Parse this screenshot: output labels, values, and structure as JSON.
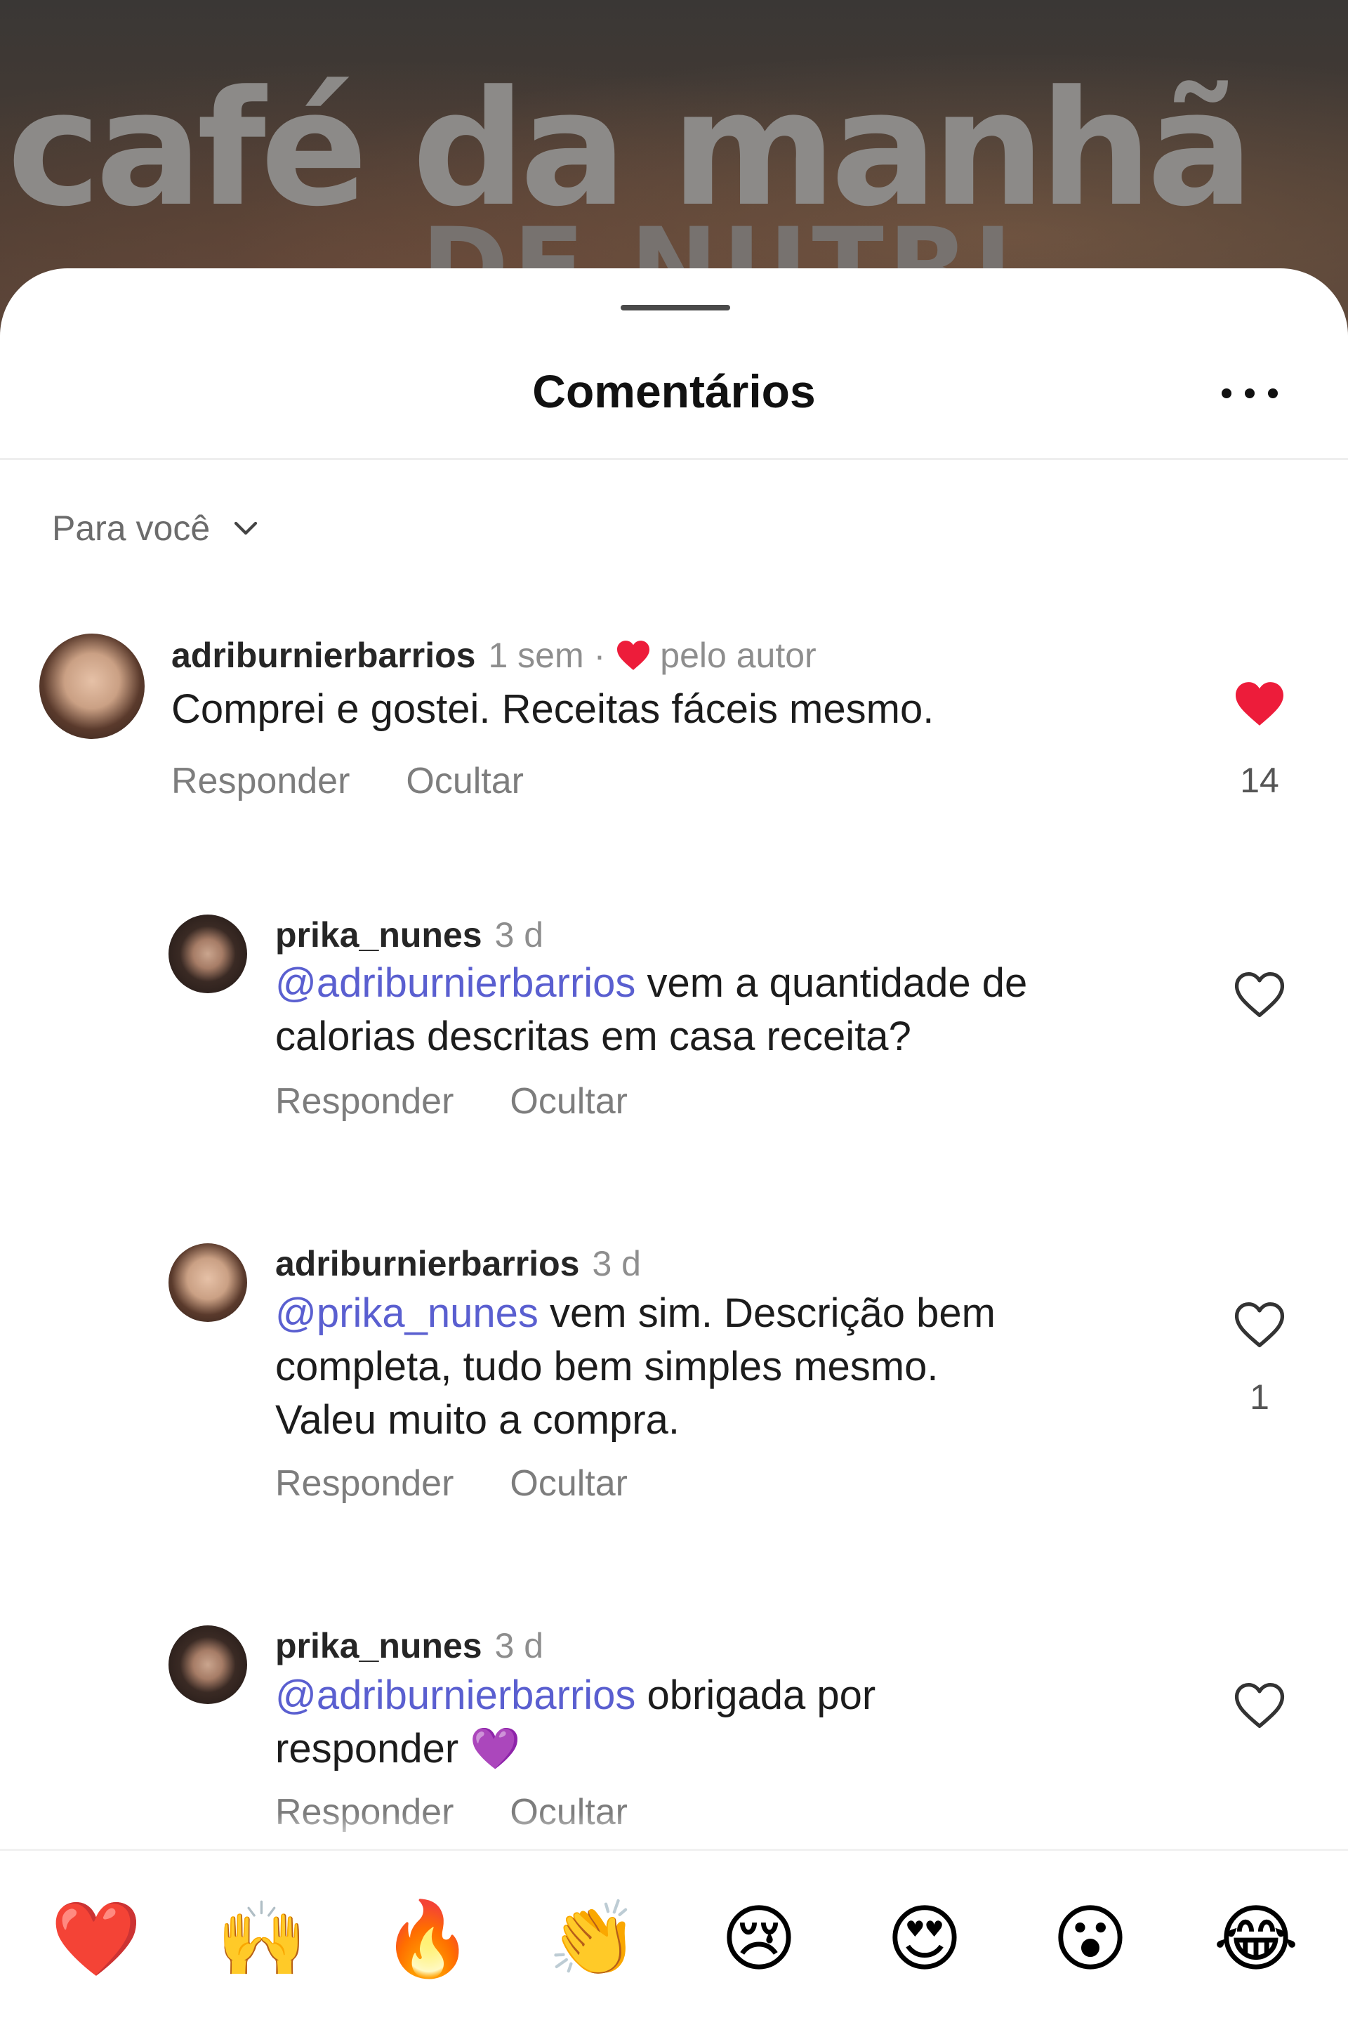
{
  "background": {
    "title": "café da manhã",
    "subtitle": "DE NUTRI"
  },
  "sheet": {
    "title": "Comentários",
    "more_icon": "more-horizontal-icon"
  },
  "filter": {
    "label": "Para você",
    "icon": "chevron-down-icon"
  },
  "comments": [
    {
      "username": "adriburnierbarrios",
      "time": "1 sem",
      "separator": "·",
      "liked_by_author_label": "pelo autor",
      "mention": "",
      "text": "Comprei e gostei. Receitas fáceis mesmo.",
      "reply_label": "Responder",
      "hide_label": "Ocultar",
      "liked": true,
      "like_count": "14"
    },
    {
      "username": "prika_nunes",
      "time": "3 d",
      "mention": "@adriburnierbarrios",
      "text_line1": " vem a quantidade de",
      "text_line2": "calorias descritas em casa receita?",
      "reply_label": "Responder",
      "hide_label": "Ocultar",
      "liked": false,
      "like_count": ""
    },
    {
      "username": "adriburnierbarrios",
      "time": "3 d",
      "mention": "@prika_nunes",
      "text_line1": " vem sim. Descrição bem",
      "text_line2": "completa, tudo bem simples mesmo.",
      "text_line3": "Valeu muito a compra.",
      "reply_label": "Responder",
      "hide_label": "Ocultar",
      "liked": false,
      "like_count": "1"
    },
    {
      "username": "prika_nunes",
      "time": "3 d",
      "mention": "@adriburnierbarrios",
      "text_line1": " obrigada por",
      "text_line2": "responder 💜",
      "reply_label": "Responder",
      "hide_label": "Ocultar",
      "liked": false,
      "like_count": ""
    }
  ],
  "reactions": [
    "❤️",
    "🙌",
    "🔥",
    "👏",
    "😢",
    "😍",
    "😮",
    "😂"
  ],
  "colors": {
    "heart_red": "#ed1c3a",
    "mention": "#5a5fd0",
    "secondary_text": "#8e8e8e"
  }
}
